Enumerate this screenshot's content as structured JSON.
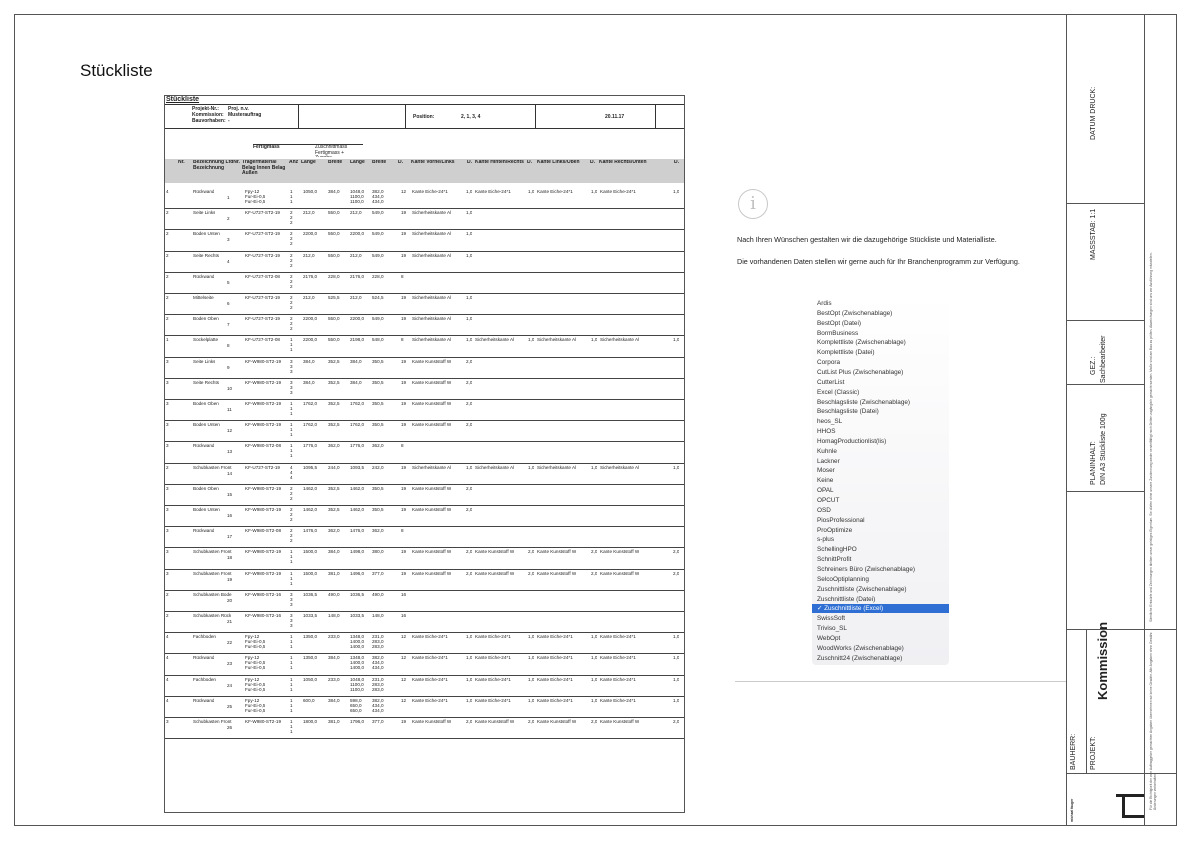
{
  "page": {
    "title": "Stückliste"
  },
  "doc": {
    "heading": "Stückliste",
    "meta_labels": [
      "Projekt-Nr.:",
      "Kommission:",
      "Bauvorhaben:"
    ],
    "meta_values": [
      "Proj. n.v.",
      "Musterauftrag",
      "-"
    ],
    "position_label": "Position:",
    "position_value": "2, 1, 3, 4",
    "date": "20.11.17",
    "group_fertigmass": "Fertigmass",
    "group_zuschnitt": "Zuschnittmass Fertigmass + Zugabe",
    "columns": {
      "nr": "Nr.",
      "bez": "Bezeichnung LfdNr. Bezeichnung",
      "traeger": "Trägermaterial Belag Innen Belag Außen",
      "anz": "Anz",
      "laenge": "Länge",
      "breite": "Breite",
      "zlaenge": "Länge",
      "zbreite": "Breite",
      "d1": "D.",
      "kante1": "Kante Vorne/Links",
      "d2": "D.",
      "kante2": "Kante Hinten/Rechts",
      "d3": "D.",
      "kante3": "Kante Links/Oben",
      "d4": "D.",
      "kante4": "Kante Rechts/Unten",
      "d5": "D."
    },
    "rows": [
      {
        "nr": "4",
        "bez": "Rückwand",
        "lfd": "1",
        "mat": [
          "Fpy-12",
          "Fur-Ei-0,5",
          "Fur-Ei-0,5"
        ],
        "anz": [
          "1",
          "1",
          "1"
        ],
        "l": "1050,0",
        "b": "384,0",
        "zl": [
          "1048,0",
          "1100,0",
          "1100,0"
        ],
        "zb": [
          "382,0",
          "434,0",
          "434,0"
        ],
        "d1": "12",
        "k1": "Kante Eiche-24*1",
        "d2": "1,0",
        "k2": "Kante Eiche-24*1",
        "d3": "1,0",
        "k3": "Kante Eiche-24*1",
        "d4": "1,0",
        "k4": "Kante Eiche-24*1",
        "d5": "1,0"
      },
      {
        "nr": "2",
        "bez": "Seite Links",
        "lfd": "2",
        "mat": [
          "KF-U727-ST2-19"
        ],
        "anz": [
          "2",
          "2",
          "2"
        ],
        "l": "212,0",
        "b": "550,0",
        "zl": [
          "212,0"
        ],
        "zb": [
          "549,0"
        ],
        "d1": "19",
        "k1": "Sicherheitskante Al",
        "d2": "1,0",
        "k2": "",
        "d3": "",
        "k3": "",
        "d4": "",
        "k4": "",
        "d5": ""
      },
      {
        "nr": "2",
        "bez": "Boden Unten",
        "lfd": "3",
        "mat": [
          "KF-U727-ST2-19"
        ],
        "anz": [
          "2",
          "2",
          "2"
        ],
        "l": "2200,0",
        "b": "550,0",
        "zl": [
          "2200,0"
        ],
        "zb": [
          "549,0"
        ],
        "d1": "19",
        "k1": "Sicherheitskante Al",
        "d2": "1,0",
        "k2": "",
        "d3": "",
        "k3": "",
        "d4": "",
        "k4": "",
        "d5": ""
      },
      {
        "nr": "2",
        "bez": "Seite Rechts",
        "lfd": "4",
        "mat": [
          "KF-U727-ST2-19"
        ],
        "anz": [
          "2",
          "2",
          "2"
        ],
        "l": "212,0",
        "b": "550,0",
        "zl": [
          "212,0"
        ],
        "zb": [
          "549,0"
        ],
        "d1": "19",
        "k1": "Sicherheitskante Al",
        "d2": "1,0",
        "k2": "",
        "d3": "",
        "k3": "",
        "d4": "",
        "k4": "",
        "d5": ""
      },
      {
        "nr": "2",
        "bez": "Rückwand",
        "lfd": "5",
        "mat": [
          "KF-U727-ST2-08"
        ],
        "anz": [
          "2",
          "2",
          "2"
        ],
        "l": "2176,0",
        "b": "228,0",
        "zl": [
          "2176,0"
        ],
        "zb": [
          "228,0"
        ],
        "d1": "8",
        "k1": "",
        "d2": "",
        "k2": "",
        "d3": "",
        "k3": "",
        "d4": "",
        "k4": "",
        "d5": ""
      },
      {
        "nr": "2",
        "bez": "Mittelseite",
        "lfd": "6",
        "mat": [
          "KF-U727-ST2-19"
        ],
        "anz": [
          "2",
          "2",
          "2"
        ],
        "l": "212,0",
        "b": "525,5",
        "zl": [
          "212,0"
        ],
        "zb": [
          "524,5"
        ],
        "d1": "19",
        "k1": "Sicherheitskante Al",
        "d2": "1,0",
        "k2": "",
        "d3": "",
        "k3": "",
        "d4": "",
        "k4": "",
        "d5": ""
      },
      {
        "nr": "2",
        "bez": "Boden Oben",
        "lfd": "7",
        "mat": [
          "KF-U727-ST2-19"
        ],
        "anz": [
          "2",
          "2",
          "2"
        ],
        "l": "2200,0",
        "b": "550,0",
        "zl": [
          "2200,0"
        ],
        "zb": [
          "549,0"
        ],
        "d1": "19",
        "k1": "Sicherheitskante Al",
        "d2": "1,0",
        "k2": "",
        "d3": "",
        "k3": "",
        "d4": "",
        "k4": "",
        "d5": ""
      },
      {
        "nr": "1",
        "bez": "Sockelplatte",
        "lfd": "8",
        "mat": [
          "KF-U727-ST2-08"
        ],
        "anz": [
          "1",
          "1",
          "1"
        ],
        "l": "2200,0",
        "b": "550,0",
        "zl": [
          "2198,0"
        ],
        "zb": [
          "548,0"
        ],
        "d1": "8",
        "k1": "Sicherheitskante Al",
        "d2": "1,0",
        "k2": "Sicherheitskante Al",
        "d3": "1,0",
        "k3": "Sicherheitskante Al",
        "d4": "1,0",
        "k4": "Sicherheitskante Al",
        "d5": "1,0"
      },
      {
        "nr": "3",
        "bez": "Seite Links",
        "lfd": "9",
        "mat": [
          "KF-W980-ST2-19"
        ],
        "anz": [
          "3",
          "3",
          "3"
        ],
        "l": "384,0",
        "b": "352,5",
        "zl": [
          "384,0"
        ],
        "zb": [
          "350,5"
        ],
        "d1": "19",
        "k1": "Kante Kunststoff W",
        "d2": "2,0",
        "k2": "",
        "d3": "",
        "k3": "",
        "d4": "",
        "k4": "",
        "d5": ""
      },
      {
        "nr": "3",
        "bez": "Seite Rechts",
        "lfd": "10",
        "mat": [
          "KF-W980-ST2-19"
        ],
        "anz": [
          "3",
          "3",
          "3"
        ],
        "l": "384,0",
        "b": "352,5",
        "zl": [
          "384,0"
        ],
        "zb": [
          "350,5"
        ],
        "d1": "19",
        "k1": "Kante Kunststoff W",
        "d2": "2,0",
        "k2": "",
        "d3": "",
        "k3": "",
        "d4": "",
        "k4": "",
        "d5": ""
      },
      {
        "nr": "3",
        "bez": "Boden Oben",
        "lfd": "11",
        "mat": [
          "KF-W980-ST2-19"
        ],
        "anz": [
          "1",
          "1",
          "1"
        ],
        "l": "1762,0",
        "b": "352,5",
        "zl": [
          "1762,0"
        ],
        "zb": [
          "350,5"
        ],
        "d1": "19",
        "k1": "Kante Kunststoff W",
        "d2": "2,0",
        "k2": "",
        "d3": "",
        "k3": "",
        "d4": "",
        "k4": "",
        "d5": ""
      },
      {
        "nr": "3",
        "bez": "Boden Unten",
        "lfd": "12",
        "mat": [
          "KF-W980-ST2-19"
        ],
        "anz": [
          "1",
          "1",
          "1"
        ],
        "l": "1762,0",
        "b": "352,5",
        "zl": [
          "1762,0"
        ],
        "zb": [
          "350,5"
        ],
        "d1": "19",
        "k1": "Kante Kunststoff W",
        "d2": "2,0",
        "k2": "",
        "d3": "",
        "k3": "",
        "d4": "",
        "k4": "",
        "d5": ""
      },
      {
        "nr": "3",
        "bez": "Rückwand",
        "lfd": "13",
        "mat": [
          "KF-W980-ST2-08"
        ],
        "anz": [
          "1",
          "1",
          "1"
        ],
        "l": "1776,0",
        "b": "362,0",
        "zl": [
          "1776,0"
        ],
        "zb": [
          "362,0"
        ],
        "d1": "8",
        "k1": "",
        "d2": "",
        "k2": "",
        "d3": "",
        "k3": "",
        "d4": "",
        "k4": "",
        "d5": ""
      },
      {
        "nr": "2",
        "bez": "Schubkasten Front",
        "lfd": "14",
        "mat": [
          "KF-U727-ST2-19"
        ],
        "anz": [
          "4",
          "4",
          "4"
        ],
        "l": "1095,5",
        "b": "244,0",
        "zl": [
          "1093,5"
        ],
        "zb": [
          "242,0"
        ],
        "d1": "19",
        "k1": "Sicherheitskante Al",
        "d2": "1,0",
        "k2": "Sicherheitskante Al",
        "d3": "1,0",
        "k3": "Sicherheitskante Al",
        "d4": "1,0",
        "k4": "Sicherheitskante Al",
        "d5": "1,0"
      },
      {
        "nr": "3",
        "bez": "Boden Oben",
        "lfd": "15",
        "mat": [
          "KF-W980-ST2-19"
        ],
        "anz": [
          "2",
          "2",
          "2"
        ],
        "l": "1462,0",
        "b": "352,5",
        "zl": [
          "1462,0"
        ],
        "zb": [
          "350,5"
        ],
        "d1": "19",
        "k1": "Kante Kunststoff W",
        "d2": "2,0",
        "k2": "",
        "d3": "",
        "k3": "",
        "d4": "",
        "k4": "",
        "d5": ""
      },
      {
        "nr": "3",
        "bez": "Boden Unten",
        "lfd": "16",
        "mat": [
          "KF-W980-ST2-19"
        ],
        "anz": [
          "2",
          "2",
          "2"
        ],
        "l": "1462,0",
        "b": "352,5",
        "zl": [
          "1462,0"
        ],
        "zb": [
          "350,5"
        ],
        "d1": "19",
        "k1": "Kante Kunststoff W",
        "d2": "2,0",
        "k2": "",
        "d3": "",
        "k3": "",
        "d4": "",
        "k4": "",
        "d5": ""
      },
      {
        "nr": "3",
        "bez": "Rückwand",
        "lfd": "17",
        "mat": [
          "KF-W980-ST2-08"
        ],
        "anz": [
          "2",
          "2",
          "2"
        ],
        "l": "1476,0",
        "b": "362,0",
        "zl": [
          "1476,0"
        ],
        "zb": [
          "362,0"
        ],
        "d1": "8",
        "k1": "",
        "d2": "",
        "k2": "",
        "d3": "",
        "k3": "",
        "d4": "",
        "k4": "",
        "d5": ""
      },
      {
        "nr": "3",
        "bez": "Schubkasten Front",
        "lfd": "18",
        "mat": [
          "KF-W980-ST2-19"
        ],
        "anz": [
          "1",
          "1",
          "1"
        ],
        "l": "1500,0",
        "b": "384,0",
        "zl": [
          "1498,0"
        ],
        "zb": [
          "380,0"
        ],
        "d1": "19",
        "k1": "Kante Kunststoff W",
        "d2": "2,0",
        "k2": "Kante Kunststoff W",
        "d3": "2,0",
        "k3": "Kante Kunststoff W",
        "d4": "2,0",
        "k4": "Kante Kunststoff W",
        "d5": "2,0"
      },
      {
        "nr": "3",
        "bez": "Schubkasten Front",
        "lfd": "19",
        "mat": [
          "KF-W980-ST2-19"
        ],
        "anz": [
          "1",
          "1",
          "1"
        ],
        "l": "1500,0",
        "b": "381,0",
        "zl": [
          "1496,0"
        ],
        "zb": [
          "377,0"
        ],
        "d1": "19",
        "k1": "Kante Kunststoff W",
        "d2": "2,0",
        "k2": "Kante Kunststoff W",
        "d3": "2,0",
        "k3": "Kante Kunststoff W",
        "d4": "2,0",
        "k4": "Kante Kunststoff W",
        "d5": "2,0"
      },
      {
        "nr": "2",
        "bez": "Schubkasten Bode",
        "lfd": "20",
        "mat": [
          "KF-W980-ST2-16"
        ],
        "anz": [
          "3",
          "3",
          "3"
        ],
        "l": "1036,5",
        "b": "490,0",
        "zl": [
          "1036,5"
        ],
        "zb": [
          "490,0"
        ],
        "d1": "16",
        "k1": "",
        "d2": "",
        "k2": "",
        "d3": "",
        "k3": "",
        "d4": "",
        "k4": "",
        "d5": ""
      },
      {
        "nr": "2",
        "bez": "Schubkasten Rück",
        "lfd": "21",
        "mat": [
          "KF-W980-ST2-16"
        ],
        "anz": [
          "3",
          "3",
          "3"
        ],
        "l": "1033,5",
        "b": "148,0",
        "zl": [
          "1033,5"
        ],
        "zb": [
          "148,0"
        ],
        "d1": "16",
        "k1": "",
        "d2": "",
        "k2": "",
        "d3": "",
        "k3": "",
        "d4": "",
        "k4": "",
        "d5": ""
      },
      {
        "nr": "4",
        "bez": "Fachboden",
        "lfd": "22",
        "mat": [
          "Fpy-12",
          "Fur-Ei-0,5",
          "Fur-Ei-0,5"
        ],
        "anz": [
          "1",
          "1",
          "1"
        ],
        "l": "1350,0",
        "b": "233,0",
        "zl": [
          "1348,0",
          "1400,0",
          "1400,0"
        ],
        "zb": [
          "231,0",
          "283,0",
          "283,0"
        ],
        "d1": "12",
        "k1": "Kante Eiche-24*1",
        "d2": "1,0",
        "k2": "Kante Eiche-24*1",
        "d3": "1,0",
        "k3": "Kante Eiche-24*1",
        "d4": "1,0",
        "k4": "Kante Eiche-24*1",
        "d5": "1,0"
      },
      {
        "nr": "4",
        "bez": "Rückwand",
        "lfd": "23",
        "mat": [
          "Fpy-12",
          "Fur-Ei-0,5",
          "Fur-Ei-0,5"
        ],
        "anz": [
          "1",
          "1",
          "1"
        ],
        "l": "1350,0",
        "b": "384,0",
        "zl": [
          "1348,0",
          "1400,0",
          "1400,0"
        ],
        "zb": [
          "382,0",
          "434,0",
          "434,0"
        ],
        "d1": "12",
        "k1": "Kante Eiche-24*1",
        "d2": "1,0",
        "k2": "Kante Eiche-24*1",
        "d3": "1,0",
        "k3": "Kante Eiche-24*1",
        "d4": "1,0",
        "k4": "Kante Eiche-24*1",
        "d5": "1,0"
      },
      {
        "nr": "4",
        "bez": "Fachboden",
        "lfd": "24",
        "mat": [
          "Fpy-12",
          "Fur-Ei-0,5",
          "Fur-Ei-0,5"
        ],
        "anz": [
          "1",
          "1",
          "1"
        ],
        "l": "1050,0",
        "b": "233,0",
        "zl": [
          "1048,0",
          "1100,0",
          "1100,0"
        ],
        "zb": [
          "231,0",
          "283,0",
          "283,0"
        ],
        "d1": "12",
        "k1": "Kante Eiche-24*1",
        "d2": "1,0",
        "k2": "Kante Eiche-24*1",
        "d3": "1,0",
        "k3": "Kante Eiche-24*1",
        "d4": "1,0",
        "k4": "Kante Eiche-24*1",
        "d5": "1,0"
      },
      {
        "nr": "4",
        "bez": "Rückwand",
        "lfd": "25",
        "mat": [
          "Fpy-12",
          "Fur-Ei-0,5",
          "Fur-Ei-0,5"
        ],
        "anz": [
          "1",
          "1",
          "1"
        ],
        "l": "600,0",
        "b": "384,0",
        "zl": [
          "598,0",
          "650,0",
          "650,0"
        ],
        "zb": [
          "382,0",
          "434,0",
          "434,0"
        ],
        "d1": "12",
        "k1": "Kante Eiche-24*1",
        "d2": "1,0",
        "k2": "Kante Eiche-24*1",
        "d3": "1,0",
        "k3": "Kante Eiche-24*1",
        "d4": "1,0",
        "k4": "Kante Eiche-24*1",
        "d5": "1,0"
      },
      {
        "nr": "3",
        "bez": "Schubkasten Front",
        "lfd": "26",
        "mat": [
          "KF-W980-ST2-19"
        ],
        "anz": [
          "1",
          "1",
          "1"
        ],
        "l": "1800,0",
        "b": "381,0",
        "zl": [
          "1796,0"
        ],
        "zb": [
          "377,0"
        ],
        "d1": "19",
        "k1": "Kante Kunststoff W",
        "d2": "2,0",
        "k2": "Kante Kunststoff W",
        "d3": "2,0",
        "k3": "Kante Kunststoff W",
        "d4": "2,0",
        "k4": "Kante Kunststoff W",
        "d5": "2,0"
      }
    ]
  },
  "info": {
    "icon": "info-icon",
    "line1": "Nach Ihren Wünschen gestalten wir die dazugehörige Stückliste und Materialliste.",
    "line2": "Die vorhandenen Daten stellen wir gerne auch für Ihr Branchenprogramm zur Verfügung."
  },
  "export_list": {
    "items": [
      "Ardis",
      "BestOpt (Zwischenablage)",
      "BestOpt (Datei)",
      "BormBusiness",
      "Komplettliste (Zwischenablage)",
      "Komplettliste (Datei)",
      "Corpora",
      "CutList Plus (Zwischenablage)",
      "CutterList",
      "Excel (Classic)",
      "Beschlagsliste (Zwischenablage)",
      "Beschlagsliste (Datei)",
      "heos_SL",
      "HHOS",
      "HomagProductionlist(lis)",
      "Kuhnle",
      "Lackner",
      "Moser",
      "Keine",
      "OPAL",
      "OPCUT",
      "OSD",
      "PiosProfessional",
      "ProOptimize",
      "s-plus",
      "SchellingHPO",
      "SchnittProfit",
      "Schreiners Büro (Zwischenablage)",
      "SelcoOptiplanning",
      "Zuschnittliste (Zwischenablage)",
      "Zuschnittliste (Datei)",
      "✓ Zuschnittliste (Excel)",
      "SwissSoft",
      "Triviso_SL",
      "WebOpt",
      "WoodWorks (Zwischenablage)",
      "Zuschnitt24 (Zwischenablage)"
    ],
    "selected_index": 31,
    "selected_color": "#2f6fd3"
  },
  "title_block": {
    "datum_druck": "DATUM DRUCK:",
    "massstab": "MASSSTAB: 1:1",
    "gez_label": "GEZ.:",
    "gez_value": "Sachbearbeiter",
    "planinhalt_label": "PLANINHALT:",
    "planinhalt_value": "DIN A3  Stückliste 100g",
    "kommission": "Kommission",
    "bauherr": "BAUHERR:",
    "projekt": "PROJEKT:",
    "company": "michael fauger",
    "disclaimer_top": "Sämtliche Entwürfe und Zeichnungen bleiben unser geistiges Eigentum. Sie dürfen ohne unsere Zustimmung weder vervielfältigt noch Dritten zugänglich gemacht werden. Maße sind am Bau zu prüfen. Abweichungen sind uns vor Ausführung mitzuteilen.",
    "disclaimer_bottom": "Für die Richtigkeit der vom Auftraggeber gemachten Angaben übernehmen wir keine Gewähr. Alle Angaben ohne Gewähr. Änderungen vorbehalten."
  }
}
